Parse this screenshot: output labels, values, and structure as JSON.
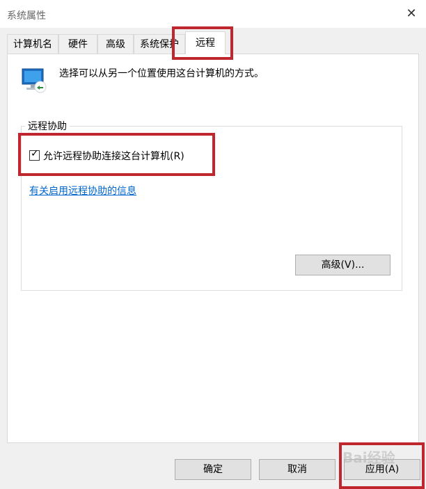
{
  "window": {
    "title": "系统属性",
    "close_glyph": "✕"
  },
  "tabs": [
    {
      "label": "计算机名"
    },
    {
      "label": "硬件"
    },
    {
      "label": "高级"
    },
    {
      "label": "系统保护"
    },
    {
      "label": "远程",
      "active": true
    }
  ],
  "remote": {
    "description": "选择可以从另一个位置使用这台计算机的方式。",
    "group_title": "远程协助",
    "allow_checkbox": {
      "label": "允许远程协助连接这台计算机(R)",
      "checked": true
    },
    "info_link": "有关启用远程协助的信息",
    "advanced_button": "高级(V)..."
  },
  "footer": {
    "ok": "确定",
    "cancel": "取消",
    "apply": "应用(A)"
  },
  "annotations": {
    "highlight_color": "#c0262d"
  },
  "watermark": "Bai经验"
}
